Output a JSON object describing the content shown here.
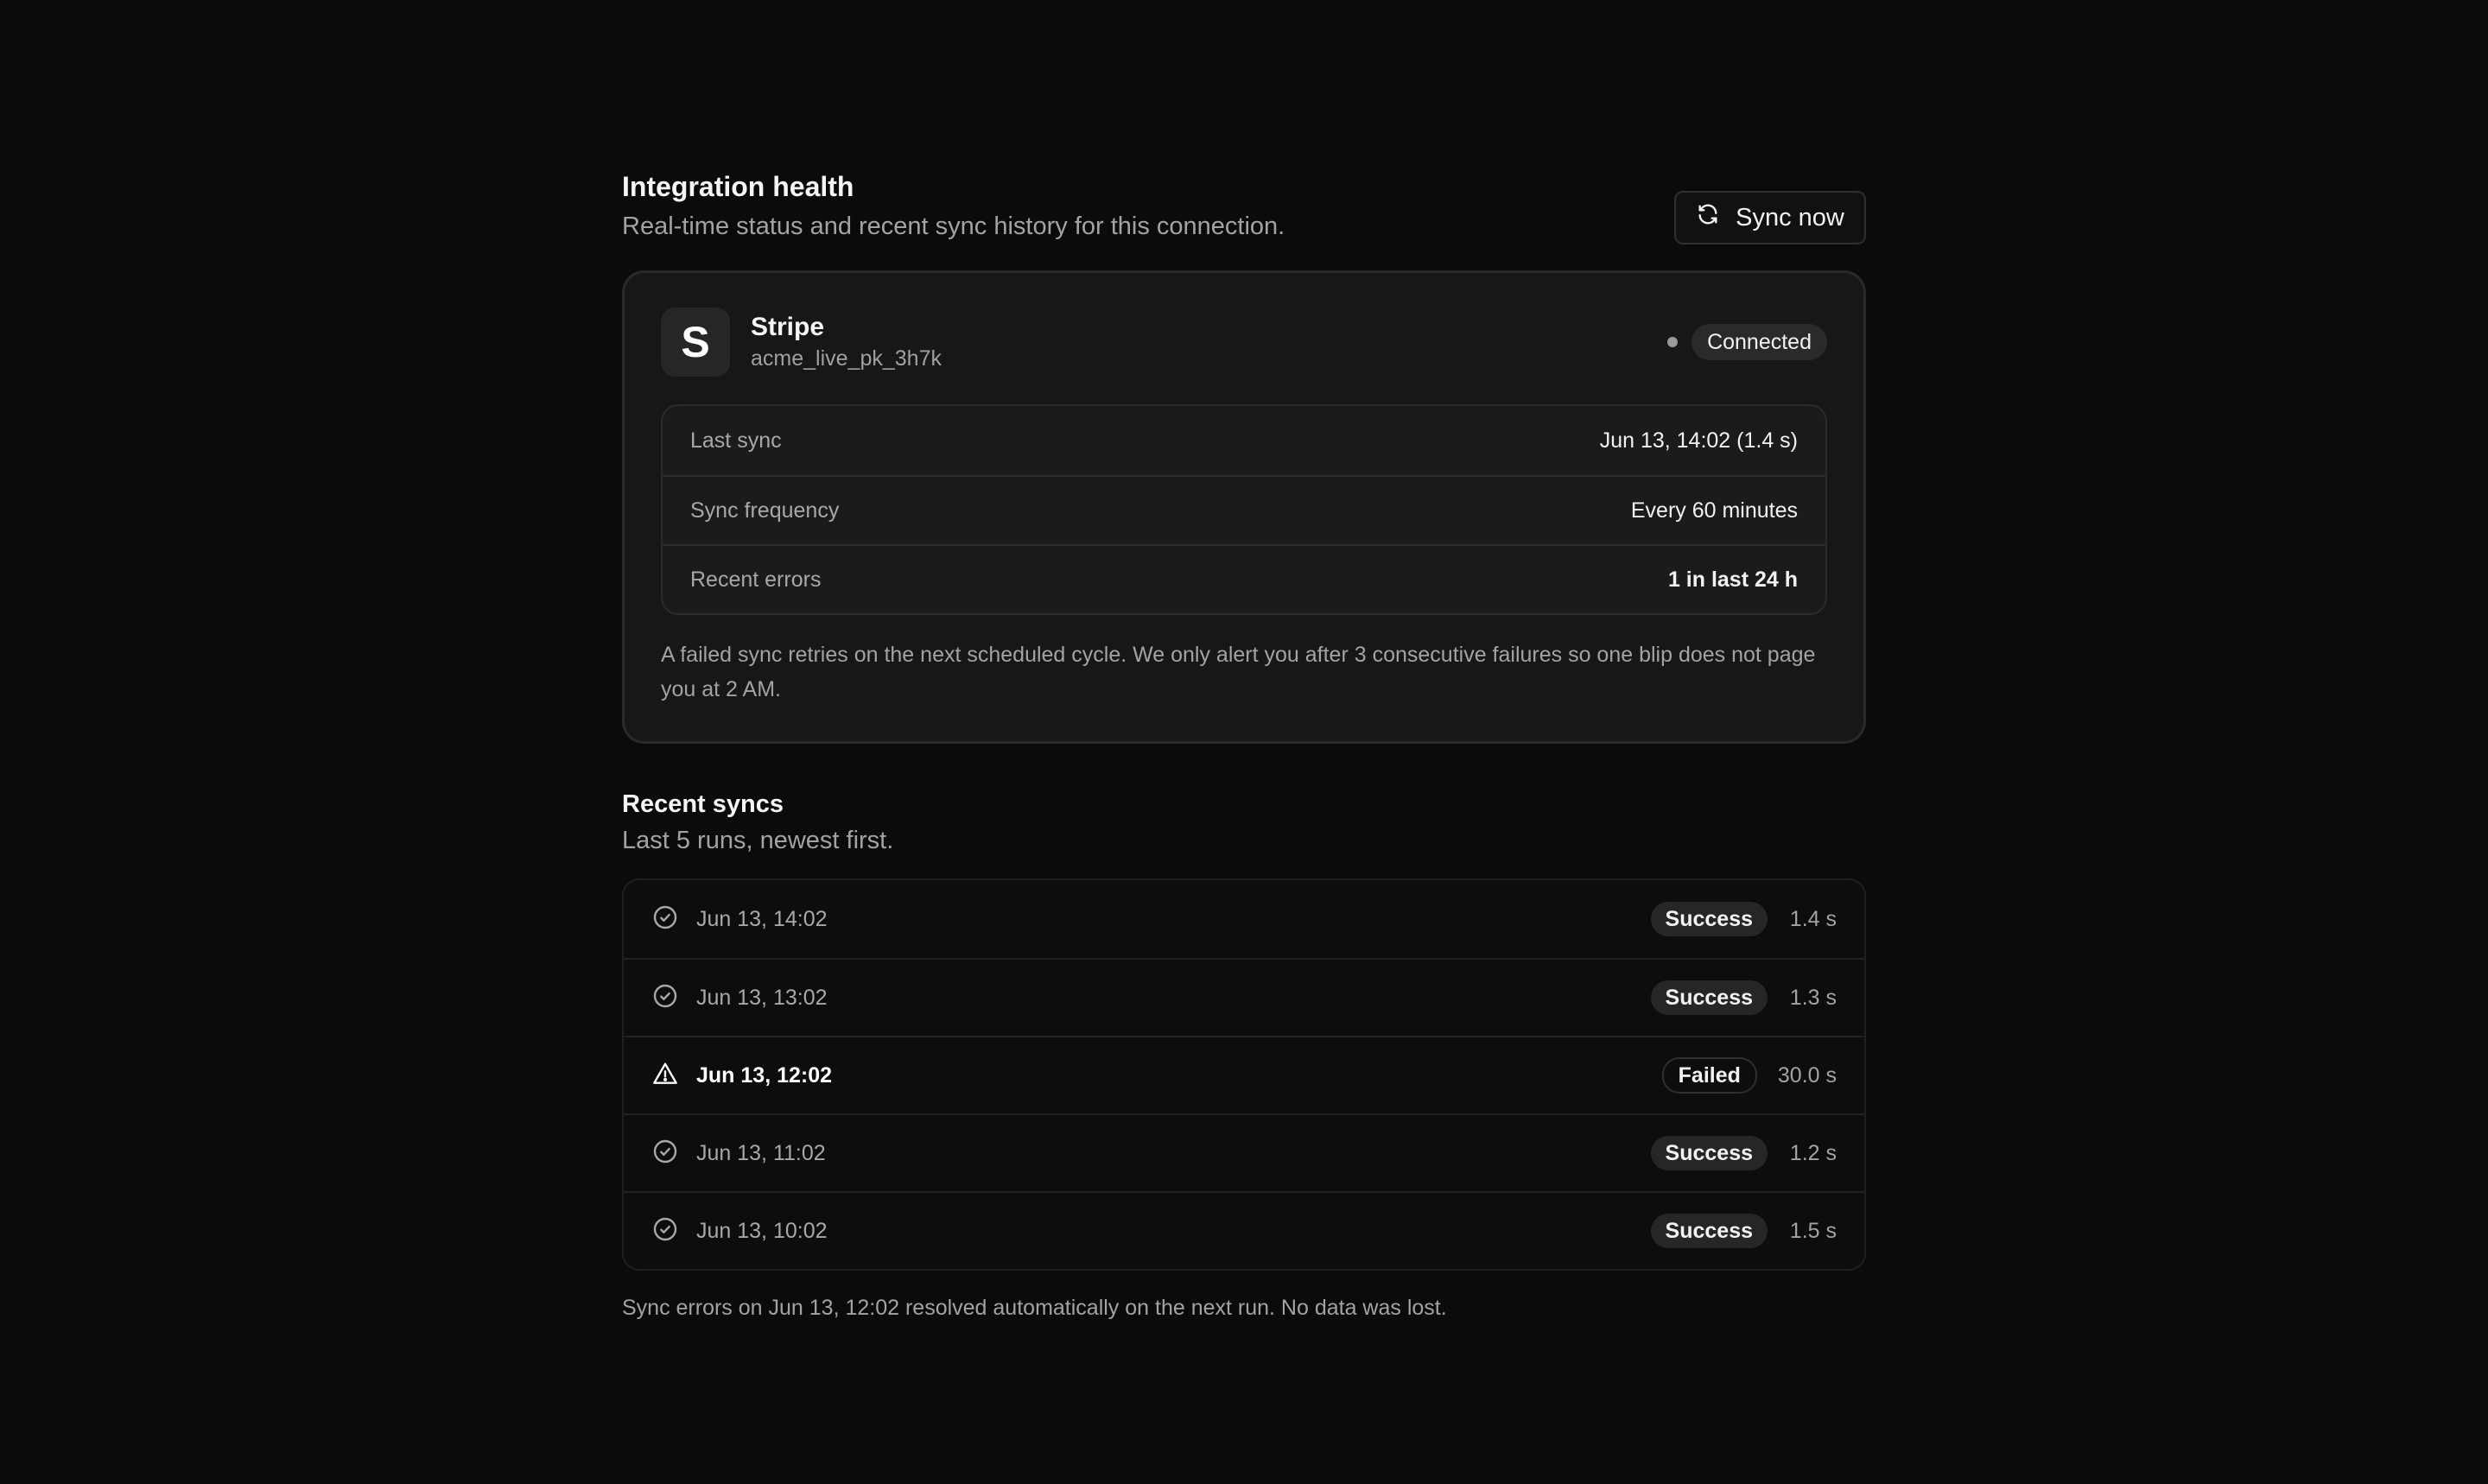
{
  "header": {
    "title": "Integration health",
    "subtitle": "Real-time status and recent sync history for this connection.",
    "sync_button_label": "Sync now"
  },
  "integration": {
    "logo_letter": "S",
    "name": "Stripe",
    "account_id": "acme_live_pk_3h7k",
    "status": "Connected",
    "stats": [
      {
        "label": "Last sync",
        "value": "Jun 13, 14:02 (1.4 s)"
      },
      {
        "label": "Sync frequency",
        "value": "Every 60 minutes"
      },
      {
        "label": "Recent errors",
        "value": "1 in last 24 h"
      }
    ],
    "note": "A failed sync retries on the next scheduled cycle. We only alert you after 3 consecutive failures so one blip does not page you at 2 AM."
  },
  "recent": {
    "title": "Recent syncs",
    "subtitle": "Last 5 runs, newest first.",
    "runs": [
      {
        "time": "Jun 13, 14:02",
        "status": "Success",
        "duration": "1.4 s",
        "icon": "check-circle-icon"
      },
      {
        "time": "Jun 13, 13:02",
        "status": "Success",
        "duration": "1.3 s",
        "icon": "check-circle-icon"
      },
      {
        "time": "Jun 13, 12:02",
        "status": "Failed",
        "duration": "30.0 s",
        "icon": "warning-triangle-icon"
      },
      {
        "time": "Jun 13, 11:02",
        "status": "Success",
        "duration": "1.2 s",
        "icon": "check-circle-icon"
      },
      {
        "time": "Jun 13, 10:02",
        "status": "Success",
        "duration": "1.5 s",
        "icon": "check-circle-icon"
      }
    ],
    "footer": "Sync errors on Jun 13, 12:02 resolved automatically on the next run. No data was lost."
  },
  "colors": {
    "background": "#0b0b0b",
    "card": "#171717",
    "muted_text": "#a3a3a3"
  }
}
